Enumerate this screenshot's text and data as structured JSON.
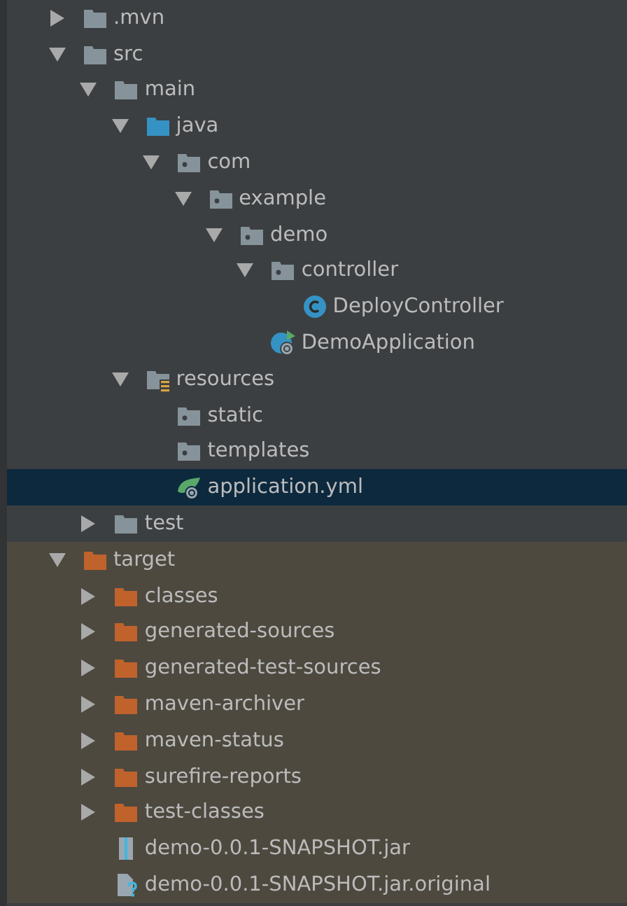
{
  "tree": [
    {
      "label": ".mvn",
      "kind": "folder",
      "expanded": false,
      "selected": false,
      "excluded": false
    },
    {
      "label": "src",
      "kind": "folder",
      "expanded": true,
      "selected": false,
      "excluded": false,
      "children": [
        {
          "label": "main",
          "kind": "folder",
          "expanded": true,
          "selected": false,
          "excluded": false,
          "children": [
            {
              "label": "java",
              "kind": "source-folder",
              "expanded": true,
              "selected": false,
              "excluded": false,
              "children": [
                {
                  "label": "com",
                  "kind": "package",
                  "expanded": true,
                  "selected": false,
                  "excluded": false,
                  "children": [
                    {
                      "label": "example",
                      "kind": "package",
                      "expanded": true,
                      "selected": false,
                      "excluded": false,
                      "children": [
                        {
                          "label": "demo",
                          "kind": "package",
                          "expanded": true,
                          "selected": false,
                          "excluded": false,
                          "children": [
                            {
                              "label": "controller",
                              "kind": "package",
                              "expanded": true,
                              "selected": false,
                              "excluded": false,
                              "children": [
                                {
                                  "label": "DeployController",
                                  "kind": "class",
                                  "selected": false,
                                  "excluded": false
                                }
                              ]
                            },
                            {
                              "label": "DemoApplication",
                              "kind": "spring-app",
                              "selected": false,
                              "excluded": false
                            }
                          ]
                        }
                      ]
                    }
                  ]
                }
              ]
            },
            {
              "label": "resources",
              "kind": "resources-folder",
              "expanded": true,
              "selected": false,
              "excluded": false,
              "children": [
                {
                  "label": "static",
                  "kind": "package",
                  "selected": false,
                  "excluded": false
                },
                {
                  "label": "templates",
                  "kind": "package",
                  "selected": false,
                  "excluded": false
                },
                {
                  "label": "application.yml",
                  "kind": "spring-config",
                  "selected": true,
                  "excluded": false
                }
              ]
            }
          ]
        },
        {
          "label": "test",
          "kind": "folder",
          "expanded": false,
          "selected": false,
          "excluded": false
        }
      ]
    },
    {
      "label": "target",
      "kind": "excluded-folder",
      "expanded": true,
      "selected": false,
      "excluded": true,
      "children": [
        {
          "label": "classes",
          "kind": "excluded-folder",
          "expanded": false,
          "selected": false,
          "excluded": true
        },
        {
          "label": "generated-sources",
          "kind": "excluded-folder",
          "expanded": false,
          "selected": false,
          "excluded": true
        },
        {
          "label": "generated-test-sources",
          "kind": "excluded-folder",
          "expanded": false,
          "selected": false,
          "excluded": true
        },
        {
          "label": "maven-archiver",
          "kind": "excluded-folder",
          "expanded": false,
          "selected": false,
          "excluded": true
        },
        {
          "label": "maven-status",
          "kind": "excluded-folder",
          "expanded": false,
          "selected": false,
          "excluded": true
        },
        {
          "label": "surefire-reports",
          "kind": "excluded-folder",
          "expanded": false,
          "selected": false,
          "excluded": true
        },
        {
          "label": "test-classes",
          "kind": "excluded-folder",
          "expanded": false,
          "selected": false,
          "excluded": true
        },
        {
          "label": "demo-0.0.1-SNAPSHOT.jar",
          "kind": "jar",
          "selected": false,
          "excluded": true
        },
        {
          "label": "demo-0.0.1-SNAPSHOT.jar.original",
          "kind": "unknown-file",
          "selected": false,
          "excluded": true
        }
      ]
    }
  ]
}
